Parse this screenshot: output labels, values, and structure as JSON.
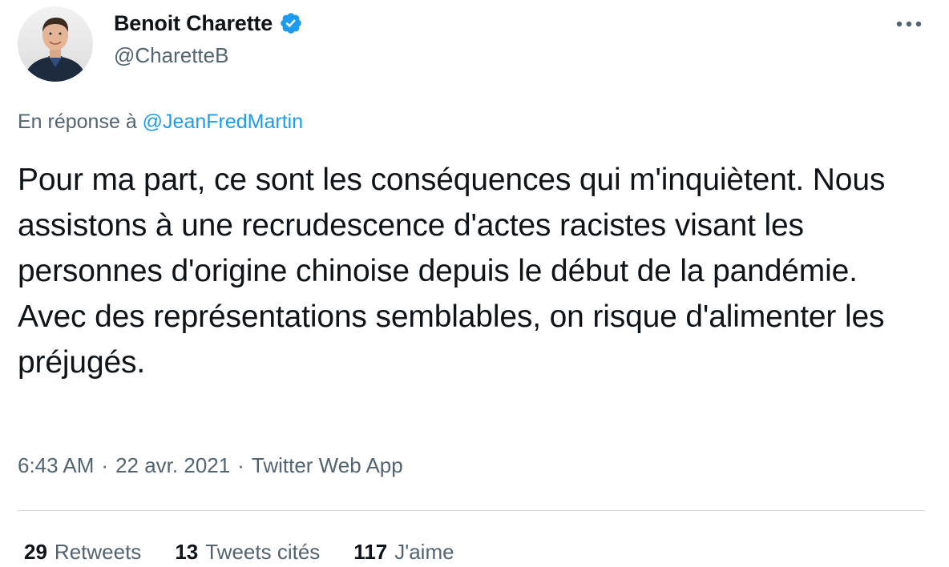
{
  "author": {
    "display_name": "Benoit Charette",
    "handle": "@CharetteB",
    "verified": true,
    "verified_icon": "verified-badge-icon",
    "verified_color": "#1d9bf0"
  },
  "reply": {
    "prefix": "En réponse à",
    "mention": "@JeanFredMartin"
  },
  "tweet": {
    "text": "Pour ma part, ce sont les conséquences qui m'inquiètent. Nous assistons à une recrudescence d'actes racistes visant les personnes d'origine chinoise depuis le début de la pandémie. Avec des représentations semblables, on risque d'alimenter les préjugés."
  },
  "meta": {
    "time": "6:43 AM",
    "separator": "·",
    "date": "22 avr. 2021",
    "source": "Twitter Web App"
  },
  "stats": {
    "retweets_count": "29",
    "retweets_label": "Retweets",
    "quotes_count": "13",
    "quotes_label": "Tweets cités",
    "likes_count": "117",
    "likes_label": "J'aime"
  },
  "colors": {
    "text_primary": "#0f1419",
    "text_secondary": "#536471",
    "link": "#1d9bf0",
    "divider": "#cfd9de"
  },
  "icons": {
    "more": "more-horizontal-icon"
  }
}
